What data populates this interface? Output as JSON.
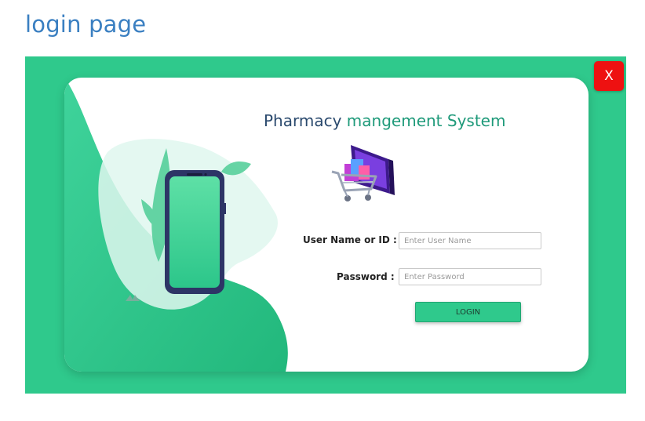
{
  "page": {
    "heading": "login page"
  },
  "window": {
    "close_label": "X"
  },
  "app": {
    "title_part1": "Pharmacy",
    "title_part2": "mangement System"
  },
  "form": {
    "username_label": "User Name or ID  :",
    "username_placeholder": "Enter User Name",
    "username_value": "",
    "password_label": "Password  :",
    "password_placeholder": "Enter Password",
    "password_value": "",
    "login_label": "LOGIN"
  },
  "colors": {
    "frame": "#2fc98c",
    "close_button": "#ee1111",
    "heading": "#3a7fc1",
    "login_button": "#2fc98c"
  },
  "icons": [
    "close-icon",
    "shopping-cart-icon",
    "smartphone-icon",
    "leaf-icon"
  ]
}
